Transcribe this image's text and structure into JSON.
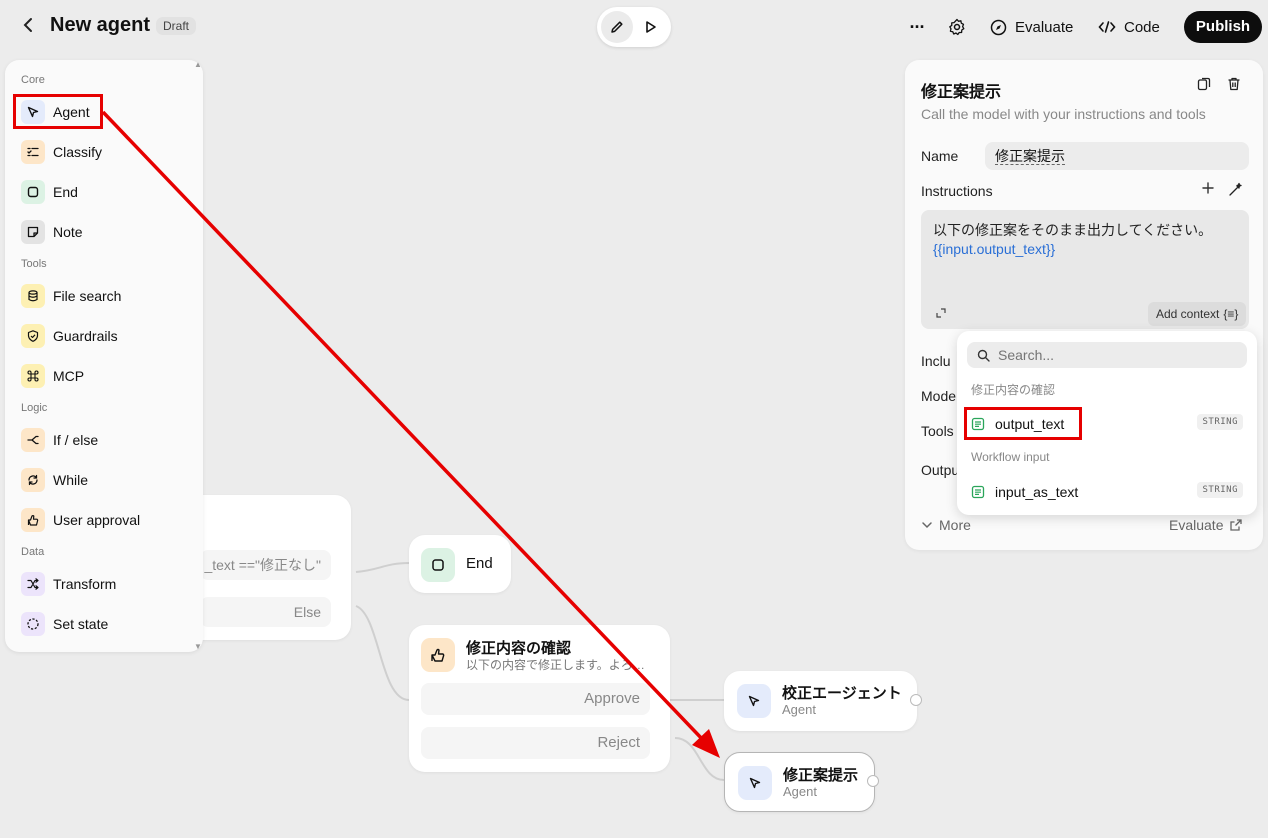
{
  "header": {
    "back_icon": "chevron-left-icon",
    "title": "New agent",
    "badge": "Draft",
    "more_label": "···",
    "evaluate_label": "Evaluate",
    "code_label": "Code",
    "publish_label": "Publish"
  },
  "palette": {
    "sections": {
      "core": "Core",
      "tools": "Tools",
      "logic": "Logic",
      "data": "Data"
    },
    "items": [
      {
        "label": "Agent",
        "icon": "cursor-arrow-icon"
      },
      {
        "label": "Classify",
        "icon": "list-icon"
      },
      {
        "label": "End",
        "icon": "square-icon"
      },
      {
        "label": "Note",
        "icon": "note-icon"
      },
      {
        "label": "File search",
        "icon": "database-icon"
      },
      {
        "label": "Guardrails",
        "icon": "shield-icon"
      },
      {
        "label": "MCP",
        "icon": "command-icon"
      },
      {
        "label": "If / else",
        "icon": "branch-icon"
      },
      {
        "label": "While",
        "icon": "loop-icon"
      },
      {
        "label": "User approval",
        "icon": "thumbs-icon"
      },
      {
        "label": "Transform",
        "icon": "shuffle-icon"
      },
      {
        "label": "Set state",
        "icon": "dashed-circle-icon"
      }
    ]
  },
  "canvas": {
    "ifelse": {
      "condition": "_text ==\"修正なし\"",
      "else_label": "Else"
    },
    "end_node": {
      "label": "End"
    },
    "approval_node": {
      "title": "修正内容の確認",
      "subtitle": "以下の内容で修正します。よろしいですか？",
      "approve_label": "Approve",
      "reject_label": "Reject"
    },
    "agent_nodes": [
      {
        "title": "校正エージェント",
        "subtitle": "Agent"
      },
      {
        "title": "修正案提示",
        "subtitle": "Agent"
      }
    ]
  },
  "inspector": {
    "title": "修正案提示",
    "description": "Call the model with your instructions and tools",
    "name_label": "Name",
    "name_value": "修正案提示",
    "instructions_label": "Instructions",
    "instructions_text": "以下の修正案をそのまま出力してください。",
    "instructions_var": "{{input.output_text}}",
    "add_context_label": "Add context",
    "add_context_icon": "{≡}",
    "hidden_labels": [
      "Inclu",
      "Mode",
      "Tools",
      "Outpu"
    ],
    "more_label": "More",
    "evaluate_label": "Evaluate"
  },
  "dropdown": {
    "search_placeholder": "Search...",
    "sections": [
      {
        "title": "修正内容の確認",
        "items": [
          {
            "name": "output_text",
            "type": "STRING"
          }
        ]
      },
      {
        "title": "Workflow input",
        "items": [
          {
            "name": "input_as_text",
            "type": "STRING"
          }
        ]
      }
    ]
  },
  "colors": {
    "annotation": "#e60000",
    "variable": "#2a6fd6",
    "publish_bg": "#0d0d0d"
  }
}
